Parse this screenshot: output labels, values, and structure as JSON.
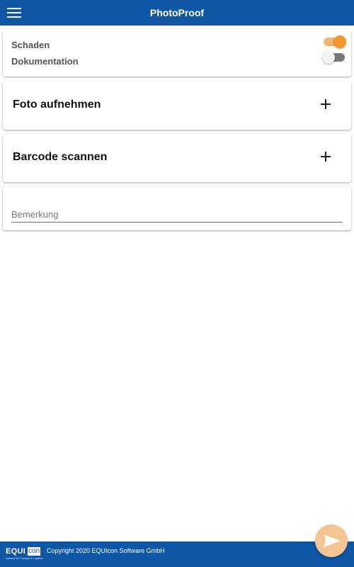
{
  "app": {
    "title": "PhotoProof"
  },
  "toggles": [
    {
      "label": "Schaden",
      "on": true
    },
    {
      "label": "Dokumentation",
      "on": false
    }
  ],
  "actions": {
    "photo_label": "Foto aufnehmen",
    "barcode_label": "Barcode scannen"
  },
  "remark": {
    "placeholder": "Bemerkung",
    "value": ""
  },
  "footer": {
    "logo_equ": "EQUI",
    "logo_con": "con",
    "logo_tagline": "Software für Transport & Logistics",
    "copyright": "Copyright 2020 EQUIcon Software GmbH"
  },
  "icons": {
    "menu": "hamburger-menu-icon",
    "add": "plus-icon",
    "send": "send-icon"
  },
  "colors": {
    "primary": "#0f56a5",
    "accent": "#f2962e",
    "fab_disabled": "#f4c592"
  }
}
